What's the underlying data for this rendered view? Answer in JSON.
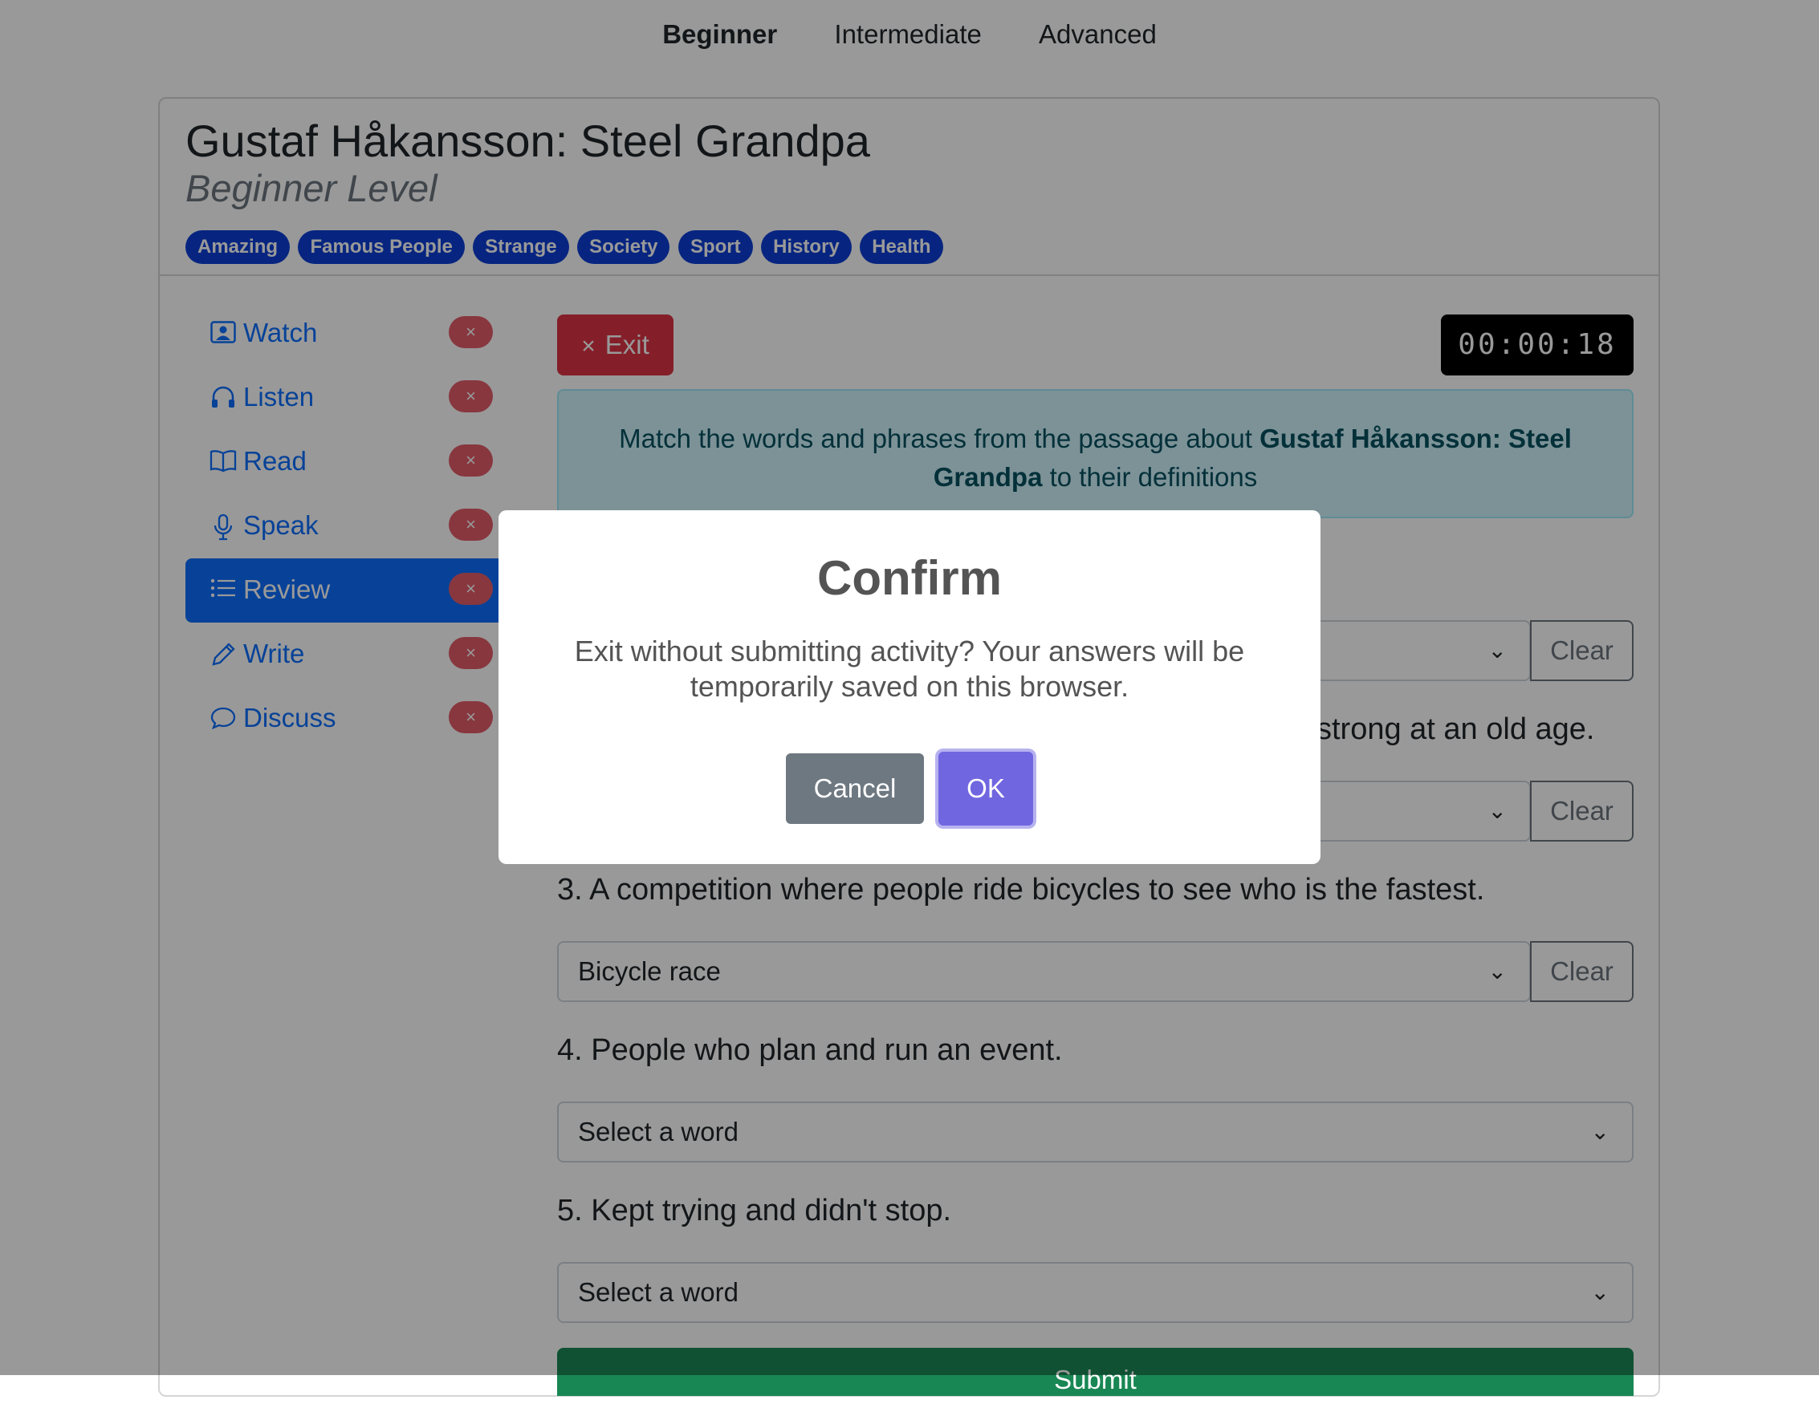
{
  "level_nav": [
    "Beginner",
    "Intermediate",
    "Advanced"
  ],
  "header": {
    "title": "Gustaf Håkansson: Steel Grandpa",
    "subtitle": "Beginner Level",
    "tags": [
      "Amazing",
      "Famous People",
      "Strange",
      "Society",
      "Sport",
      "History",
      "Health"
    ]
  },
  "sidebar": {
    "items": [
      {
        "label": "Watch",
        "icon": "person-video-icon"
      },
      {
        "label": "Listen",
        "icon": "headphones-icon"
      },
      {
        "label": "Read",
        "icon": "book-icon"
      },
      {
        "label": "Speak",
        "icon": "microphone-icon"
      },
      {
        "label": "Review",
        "icon": "list-icon"
      },
      {
        "label": "Write",
        "icon": "pencil-icon"
      },
      {
        "label": "Discuss",
        "icon": "chat-icon"
      }
    ],
    "active": "Review",
    "remove_symbol": "×"
  },
  "exit_button": {
    "label": "Exit",
    "icon": "×"
  },
  "timer": "00:00:18",
  "instruction": {
    "prefix": "Match the words and phrases from the passage about ",
    "bold": "Gustaf Håkansson: Steel Grandpa",
    "suffix": " to their definitions"
  },
  "questions": [
    {
      "text": "",
      "value": ""
    },
    {
      "text": "strong at an old age.",
      "value": ""
    },
    {
      "text": "3. A competition where people ride bicycles to see who is the fastest.",
      "value": "Bicycle race"
    },
    {
      "text": "4. People who plan and run an event.",
      "value": "Select a word"
    },
    {
      "text": "5. Kept trying and didn't stop.",
      "value": "Select a word"
    }
  ],
  "clear_label": "Clear",
  "submit_label": "Submit",
  "modal": {
    "title": "Confirm",
    "text": "Exit without submitting activity? Your answers will be temporarily saved on this browser.",
    "cancel": "Cancel",
    "ok": "OK"
  },
  "colors": {
    "primary": "#0d6efd",
    "danger": "#dc3545",
    "info_bg": "#cff4fc",
    "info_text": "#055160",
    "ok": "#7066e0",
    "cancel": "#6e7881",
    "tag": "#0d3fd6"
  }
}
